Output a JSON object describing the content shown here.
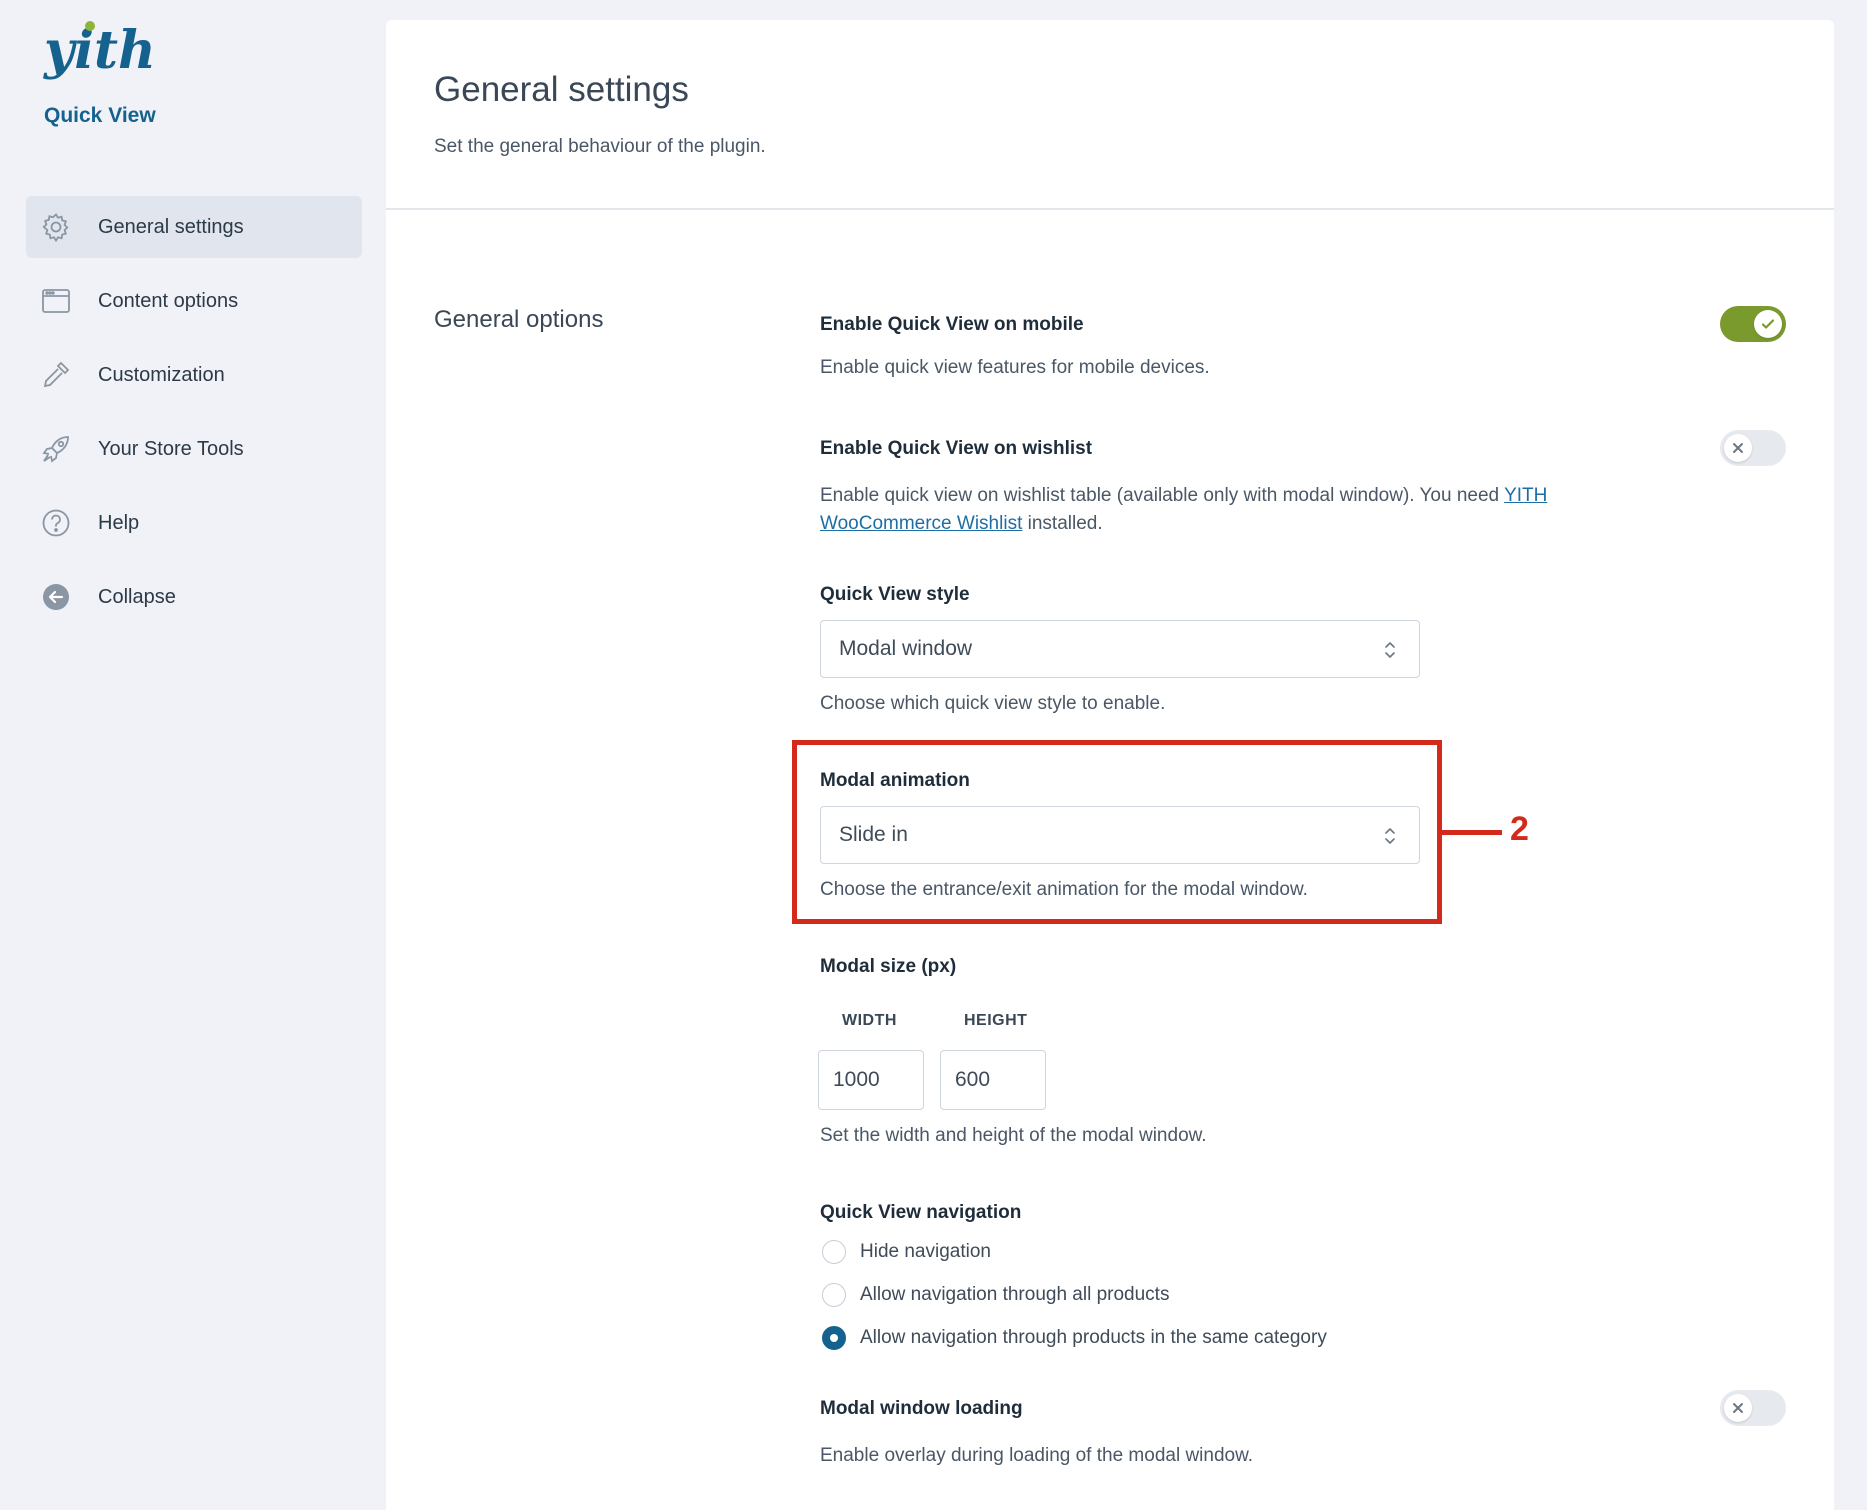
{
  "app": {
    "logo_text": "yith",
    "plugin_name": "Quick View",
    "brand_color": "#15628f",
    "accent_green": "#7a9a2e",
    "highlight_red": "#d42a1b"
  },
  "sidebar": {
    "items": [
      {
        "label": "General settings",
        "icon": "gear-icon",
        "active": true
      },
      {
        "label": "Content options",
        "icon": "browser-window-icon",
        "active": false
      },
      {
        "label": "Customization",
        "icon": "eyedropper-icon",
        "active": false
      },
      {
        "label": "Your Store Tools",
        "icon": "rocket-icon",
        "active": false
      },
      {
        "label": "Help",
        "icon": "help-circle-icon",
        "active": false
      },
      {
        "label": "Collapse",
        "icon": "collapse-arrow-icon",
        "active": false
      }
    ]
  },
  "header": {
    "title": "General settings",
    "subtitle": "Set the general behaviour of the plugin."
  },
  "section": {
    "title": "General options"
  },
  "options": {
    "mobile": {
      "label": "Enable Quick View on mobile",
      "desc": "Enable quick view features for mobile devices.",
      "enabled": true
    },
    "wishlist": {
      "label": "Enable Quick View on wishlist",
      "desc_before": "Enable quick view on wishlist table (available only with modal window). You need",
      "link_text": "YITH WooCommerce Wishlist",
      "desc_after": "installed.",
      "enabled": false
    },
    "style": {
      "label": "Quick View style",
      "value": "Modal window",
      "desc": "Choose which quick view style to enable."
    },
    "animation": {
      "label": "Modal animation",
      "value": "Slide in",
      "desc": "Choose the entrance/exit animation for the modal window."
    },
    "size": {
      "label": "Modal size (px)",
      "width_label": "WIDTH",
      "height_label": "HEIGHT",
      "width": "1000",
      "height": "600",
      "desc": "Set the width and height of the modal window."
    },
    "navigation": {
      "label": "Quick View navigation",
      "choices": [
        {
          "label": "Hide navigation",
          "checked": false
        },
        {
          "label": "Allow navigation through all products",
          "checked": false
        },
        {
          "label": "Allow navigation through products in the same category",
          "checked": true
        }
      ]
    },
    "loading": {
      "label": "Modal window loading",
      "desc": "Enable overlay during loading of the modal window.",
      "enabled": false
    }
  },
  "annotation": {
    "number": "2"
  }
}
